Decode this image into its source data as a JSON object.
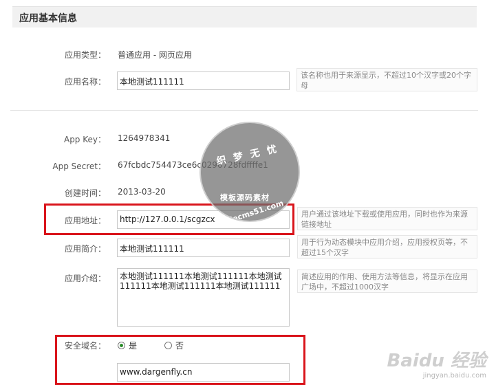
{
  "section": {
    "title": "应用基本信息"
  },
  "fields": {
    "app_type": {
      "label": "应用类型：",
      "value": "普通应用 - 网页应用"
    },
    "app_name": {
      "label": "应用名称：",
      "value": "本地测试111111",
      "hint": "该名称也用于来源显示，不超过10个汉字或20个字母"
    },
    "app_key": {
      "label": "App Key：",
      "value": "1264978341"
    },
    "app_secret": {
      "label": "App Secret：",
      "value": "67fcbdc754473ce6c0296728fdffffe1"
    },
    "created": {
      "label": "创建时间：",
      "value": "2013-03-20"
    },
    "app_url": {
      "label": "应用地址：",
      "value": "http://127.0.0.1/scgzcx",
      "hint": "用户通过该地址下载或使用应用，同时也作为来源链接地址"
    },
    "app_brief": {
      "label": "应用简介：",
      "value": "本地测试111111",
      "hint": "用于行为动态模块中应用介绍，应用授权页等，不超过15个汉字"
    },
    "app_intro": {
      "label": "应用介绍：",
      "value": "本地测试111111本地测试111111本地测试111111本地测试111111本地测试111111",
      "hint": "简述应用的作用、使用方法等信息，将显示在应用广场中，不超过1000汉字"
    },
    "secure_domain": {
      "label": "安全域名：",
      "options": [
        {
          "label": "是",
          "checked": true
        },
        {
          "label": "否",
          "checked": false
        }
      ],
      "value": "www.dargenfly.cn"
    }
  },
  "watermark": {
    "stamp_top": "织 梦 无 忧",
    "stamp_middle": "模板源码素材",
    "stamp_bottom": "dedecms51.com",
    "baidu_main": "Baidu 经验",
    "baidu_sub": "jingyan.baidu.com"
  },
  "colors": {
    "highlight": "#d9141b",
    "header_bg": "#f1f1f1",
    "radio_on": "#2a8a2a"
  }
}
